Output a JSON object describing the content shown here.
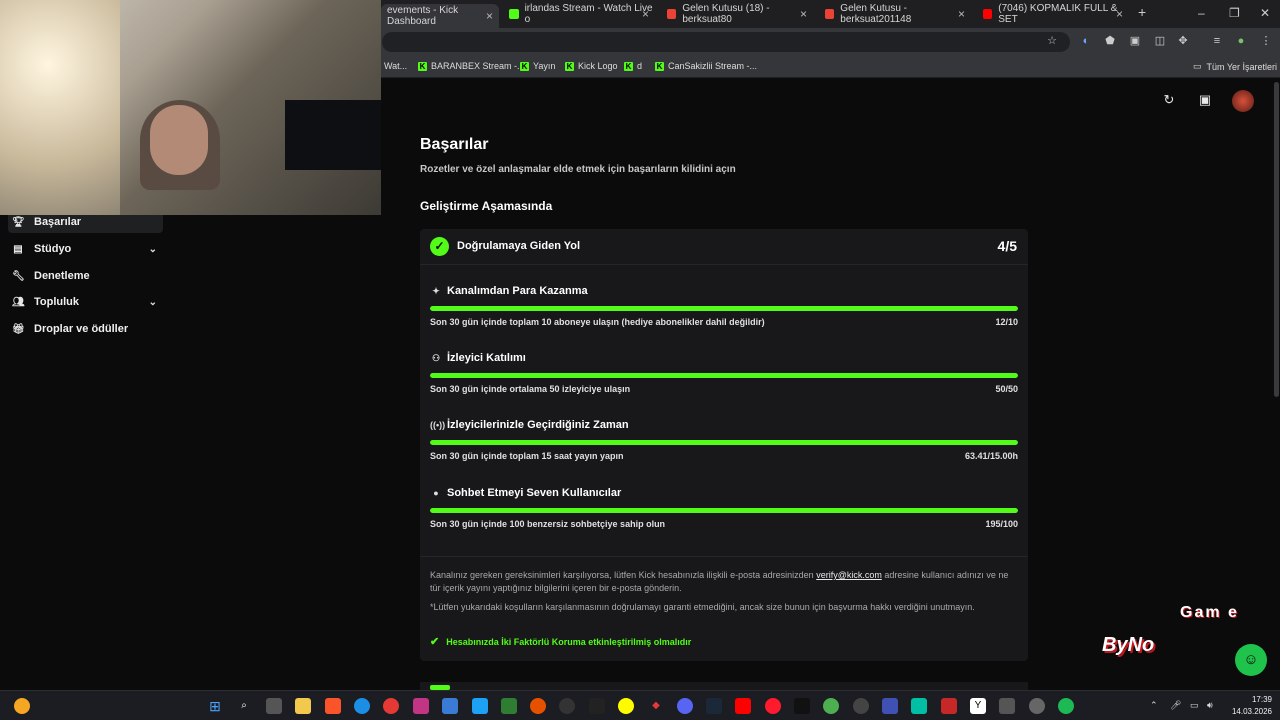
{
  "browser": {
    "tabs": [
      {
        "label": "evements - Kick Dashboard",
        "icon": "kick-icon"
      },
      {
        "label": "irlandas Stream - Watch Live o",
        "icon": "kick-icon"
      },
      {
        "label": "Gelen Kutusu (18) - berksuat80",
        "icon": "gmail-icon"
      },
      {
        "label": "Gelen Kutusu - berksuat201148",
        "icon": "gmail-icon"
      },
      {
        "label": "(7046) KOPMALIK FULL & SET",
        "icon": "youtube-icon"
      }
    ],
    "new_tab": "+",
    "bookmarks": [
      {
        "label": "Wat..."
      },
      {
        "label": "BARANBEX Stream -..."
      },
      {
        "label": "Yayın"
      },
      {
        "label": "Kick Logo"
      },
      {
        "label": "d"
      },
      {
        "label": "CanSakizlii Stream -..."
      }
    ],
    "all_bookmarks": "Tüm Yer İşaretleri"
  },
  "sidebar": {
    "items": [
      {
        "label": "Başarılar",
        "icon": "trophy-icon",
        "active": true
      },
      {
        "label": "Stüdyo",
        "icon": "studio-icon",
        "expandable": true
      },
      {
        "label": "Denetleme",
        "icon": "wrench-icon"
      },
      {
        "label": "Topluluk",
        "icon": "community-icon",
        "expandable": true
      },
      {
        "label": "Droplar ve ödüller",
        "icon": "gift-icon"
      }
    ]
  },
  "page": {
    "title": "Başarılar",
    "subtitle": "Rozetler ve özel anlaşmalar elde etmek için başarıların kilidini açın",
    "section": "Geliştirme Aşamasında"
  },
  "card": {
    "title": "Doğrulamaya Giden Yol",
    "count": "4/5",
    "requirements": [
      {
        "title": "Kanalımdan Para Kazanma",
        "icon": "sparkle-icon",
        "desc": "Son 30 gün içinde toplam 10 aboneye ulaşın (hediye abonelikler dahil değildir)",
        "value": "12/10",
        "progress": 1.0
      },
      {
        "title": "İzleyici Katılımı",
        "icon": "users-icon",
        "desc": "Son 30 gün içinde ortalama 50 izleyiciye ulaşın",
        "value": "50/50",
        "progress": 1.0
      },
      {
        "title": "İzleyicilerinizle Geçirdiğiniz Zaman",
        "icon": "broadcast-icon",
        "desc": "Son 30 gün içinde toplam 15 saat yayın yapın",
        "value": "63.41/15.00h",
        "progress": 1.0
      },
      {
        "title": "Sohbet Etmeyi Seven Kullanıcılar",
        "icon": "chat-icon",
        "desc": "Son 30 gün içinde 100 benzersiz sohbetçiye sahip olun",
        "value": "195/100",
        "progress": 1.0
      }
    ],
    "note1_a": "Kanalınız gereken gereksinimleri karşılıyorsa, lütfen Kick hesabınızla ilişkili e-posta adresinizden ",
    "note1_link": "verify@kick.com",
    "note1_b": " adresine kullanıcı adınızı ve ne tür içerik yayını yaptığınız bilgilerini içeren bir e-posta gönderin.",
    "note2": "*Lütfen yukarıdaki koşulların karşılanmasının doğrulamayı garanti etmediğini, ancak size bunun için başvurma hakkı verdiğini unutmayın.",
    "twofa": "Hesabınızda İki Faktörlü Koruma etkinleştirilmiş olmalıdır"
  },
  "overlay": {
    "logo_a": "ByNo",
    "logo_b": "Gam e"
  },
  "taskbar": {
    "time": "17:39",
    "date": "14.03.2026"
  },
  "colors": {
    "accent": "#53fc18",
    "background": "#0b0b0c",
    "card": "#18181b"
  }
}
